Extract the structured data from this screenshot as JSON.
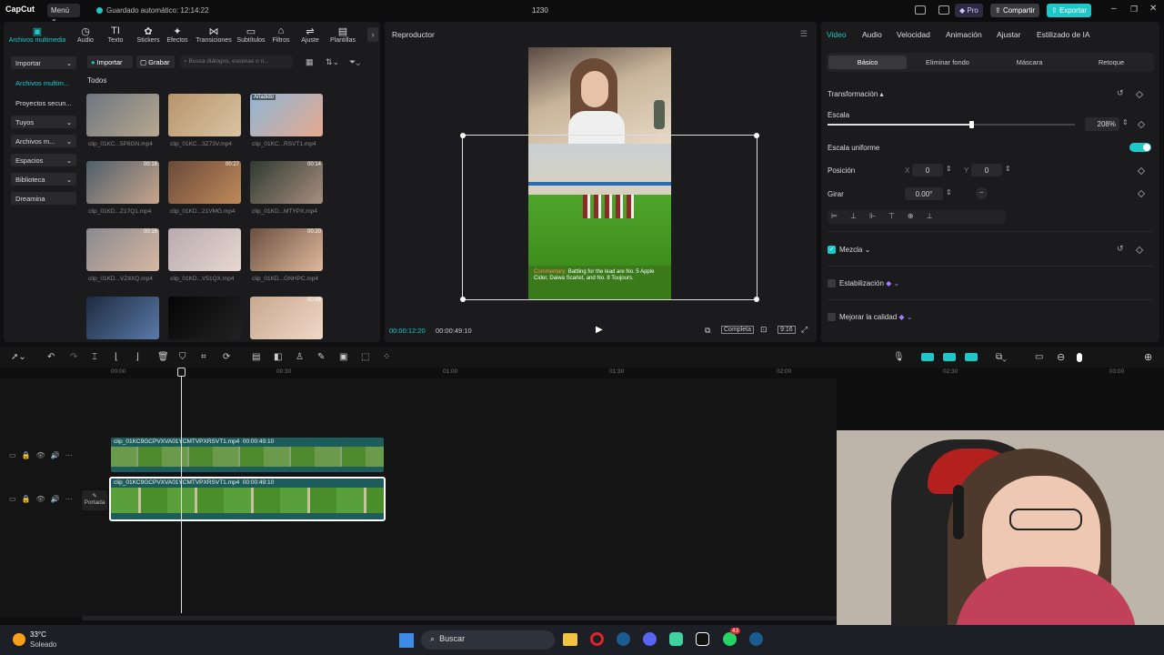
{
  "app": {
    "logo": "CapCut",
    "menu": "Menú",
    "autosave": "Guardado automático: 12:14:22",
    "title": "1230",
    "pro": "Pro",
    "share": "Compartir",
    "export": "Exportar"
  },
  "tools": [
    {
      "label": "Archivos multimedia",
      "glyph": "▣"
    },
    {
      "label": "Audio",
      "glyph": "◷"
    },
    {
      "label": "Texto",
      "glyph": "TI"
    },
    {
      "label": "Stickers",
      "glyph": "✿"
    },
    {
      "label": "Efectos",
      "glyph": "✦"
    },
    {
      "label": "Transiciones",
      "glyph": "⋈"
    },
    {
      "label": "Subtítulos",
      "glyph": "▭"
    },
    {
      "label": "Filtros",
      "glyph": "⌂"
    },
    {
      "label": "Ajuste",
      "glyph": "⇌"
    },
    {
      "label": "Plantillas",
      "glyph": "▤"
    }
  ],
  "sidebar": [
    "Importar",
    "Archivos multim...",
    "Proyectos secun...",
    "Tuyos",
    "Archivos m...",
    "Espacios",
    "Biblioteca",
    "Dreamina"
  ],
  "media": {
    "import": "Importar",
    "record": "Grabar",
    "search_placeholder": "Busca diálogos, escenas o n...",
    "section": "Todos",
    "added": "Añadido",
    "clips": [
      {
        "name": "clip_01KC...5P8GN.mp4",
        "dur": ""
      },
      {
        "name": "clip_01KC...3Z73V.mp4",
        "dur": ""
      },
      {
        "name": "clip_01KC...RSVT1.mp4",
        "dur": ""
      },
      {
        "name": "clip_01KD...Z17Q1.mp4",
        "dur": "00:16"
      },
      {
        "name": "clip_01KD...21VMG.mp4",
        "dur": "00:27"
      },
      {
        "name": "clip_01KD...MTYPX.mp4",
        "dur": "00:14"
      },
      {
        "name": "clip_01KD...VZ8XQ.mp4",
        "dur": "00:16"
      },
      {
        "name": "clip_01KD...V51QX.mp4",
        "dur": ""
      },
      {
        "name": "clip_01KD...GNHPC.mp4",
        "dur": "00:20"
      },
      {
        "name": "",
        "dur": ""
      },
      {
        "name": "",
        "dur": ""
      },
      {
        "name": "",
        "dur": "00:46"
      }
    ]
  },
  "player": {
    "title": "Reproductor",
    "current": "00:00:12:20",
    "total": "00:00:49:10",
    "quality": "Completa",
    "ratio": "9:16",
    "caption": {
      "prefix": "Commentary:",
      "text": "Battling for the lead are No. 5 Apple Cider, Daiwa Scarlet, and No. 8 Toujours."
    }
  },
  "right": {
    "tabs": [
      "Video",
      "Audio",
      "Velocidad",
      "Animación",
      "Ajustar",
      "Estilizado de IA"
    ],
    "subtabs": [
      "Básico",
      "Eliminar fondo",
      "Máscara",
      "Retoque"
    ],
    "transform": "Transformación",
    "scale_label": "Escala",
    "scale_value": "208%",
    "scale_level": 0.58,
    "uniform": "Escala uniforme",
    "position": "Posición",
    "x_label": "X",
    "x_value": "0",
    "y_label": "Y",
    "y_value": "0",
    "rotate": "Girar",
    "rotate_value": "0.00°",
    "blend": "Mezcla",
    "stabilize": "Estabilización",
    "enhance": "Mejorar la calidad"
  },
  "timeline": {
    "ticks": [
      "00:00",
      "00:30",
      "01:00",
      "01:30",
      "02:00",
      "02:30",
      "03:00"
    ],
    "clip_name": "clip_01KC9GCPVXVA01YCMTVPXRSVT1.mp4",
    "clip_dur": "00:00:49:10",
    "cover": "Portada"
  },
  "taskbar": {
    "temp": "33°C",
    "weather": "Soleado",
    "search": "Buscar",
    "badge": "43"
  },
  "colors": {
    "accent": "#1ec8c8",
    "clip": "#1c5d5c"
  }
}
